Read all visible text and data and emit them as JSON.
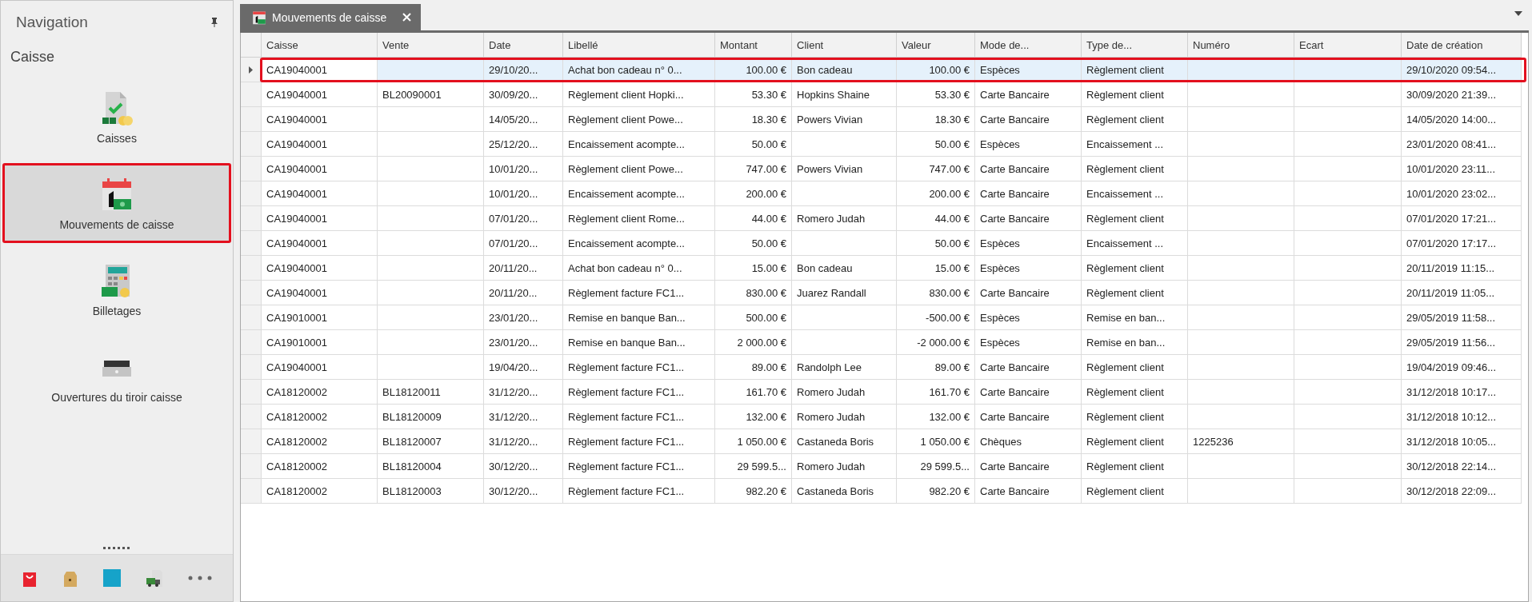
{
  "sidebar": {
    "title": "Navigation",
    "section": "Caisse",
    "items": [
      {
        "label": "Caisses",
        "selected": false
      },
      {
        "label": "Mouvements de caisse",
        "selected": true
      },
      {
        "label": "Billetages",
        "selected": false
      },
      {
        "label": "Ouvertures du tiroir caisse",
        "selected": false
      }
    ]
  },
  "tabs": [
    {
      "label": "Mouvements de caisse",
      "selected": true
    }
  ],
  "table": {
    "columns": [
      {
        "label": "Caisse",
        "kind": "text"
      },
      {
        "label": "Vente",
        "kind": "text"
      },
      {
        "label": "Date",
        "kind": "text"
      },
      {
        "label": "Libellé",
        "kind": "text"
      },
      {
        "label": "Montant",
        "kind": "amount"
      },
      {
        "label": "Client",
        "kind": "text"
      },
      {
        "label": "Valeur",
        "kind": "amount"
      },
      {
        "label": "Mode de...",
        "kind": "text"
      },
      {
        "label": "Type de...",
        "kind": "text"
      },
      {
        "label": "Numéro",
        "kind": "text"
      },
      {
        "label": "Ecart",
        "kind": "text"
      },
      {
        "label": "Date de création",
        "kind": "text"
      }
    ],
    "rows": [
      {
        "selected": true,
        "cells": [
          "CA19040001",
          null,
          "29/10/20...",
          "Achat bon cadeau n° 0...",
          "100.00 €",
          "Bon cadeau",
          "100.00 €",
          "Espèces",
          "Règlement client",
          null,
          null,
          "29/10/2020 09:54..."
        ]
      },
      {
        "selected": false,
        "cells": [
          "CA19040001",
          "BL20090001",
          "30/09/20...",
          "Règlement client Hopki...",
          "53.30 €",
          "Hopkins Shaine",
          "53.30 €",
          "Carte Bancaire",
          "Règlement client",
          null,
          null,
          "30/09/2020 21:39..."
        ]
      },
      {
        "selected": false,
        "cells": [
          "CA19040001",
          null,
          "14/05/20...",
          "Règlement client Powe...",
          "18.30 €",
          "Powers Vivian",
          "18.30 €",
          "Carte Bancaire",
          "Règlement client",
          null,
          null,
          "14/05/2020 14:00..."
        ]
      },
      {
        "selected": false,
        "cells": [
          "CA19040001",
          null,
          "25/12/20...",
          "Encaissement acompte...",
          "50.00 €",
          null,
          "50.00 €",
          "Espèces",
          "Encaissement ...",
          null,
          null,
          "23/01/2020 08:41..."
        ]
      },
      {
        "selected": false,
        "cells": [
          "CA19040001",
          null,
          "10/01/20...",
          "Règlement client Powe...",
          "747.00 €",
          "Powers Vivian",
          "747.00 €",
          "Carte Bancaire",
          "Règlement client",
          null,
          null,
          "10/01/2020 23:11..."
        ]
      },
      {
        "selected": false,
        "cells": [
          "CA19040001",
          null,
          "10/01/20...",
          "Encaissement acompte...",
          "200.00 €",
          null,
          "200.00 €",
          "Carte Bancaire",
          "Encaissement ...",
          null,
          null,
          "10/01/2020 23:02..."
        ]
      },
      {
        "selected": false,
        "cells": [
          "CA19040001",
          null,
          "07/01/20...",
          "Règlement client Rome...",
          "44.00 €",
          "Romero Judah",
          "44.00 €",
          "Carte Bancaire",
          "Règlement client",
          null,
          null,
          "07/01/2020 17:21..."
        ]
      },
      {
        "selected": false,
        "cells": [
          "CA19040001",
          null,
          "07/01/20...",
          "Encaissement acompte...",
          "50.00 €",
          null,
          "50.00 €",
          "Espèces",
          "Encaissement ...",
          null,
          null,
          "07/01/2020 17:17..."
        ]
      },
      {
        "selected": false,
        "cells": [
          "CA19040001",
          null,
          "20/11/20...",
          "Achat bon cadeau n° 0...",
          "15.00 €",
          "Bon cadeau",
          "15.00 €",
          "Espèces",
          "Règlement client",
          null,
          null,
          "20/11/2019 11:15..."
        ]
      },
      {
        "selected": false,
        "cells": [
          "CA19040001",
          null,
          "20/11/20...",
          "Règlement facture FC1...",
          "830.00 €",
          "Juarez Randall",
          "830.00 €",
          "Carte Bancaire",
          "Règlement client",
          null,
          null,
          "20/11/2019 11:05..."
        ]
      },
      {
        "selected": false,
        "cells": [
          "CA19010001",
          null,
          "23/01/20...",
          "Remise en banque Ban...",
          "500.00 €",
          null,
          "-500.00 €",
          "Espèces",
          "Remise en ban...",
          null,
          null,
          "29/05/2019 11:58..."
        ]
      },
      {
        "selected": false,
        "cells": [
          "CA19010001",
          null,
          "23/01/20...",
          "Remise en banque Ban...",
          "2 000.00 €",
          null,
          "-2 000.00 €",
          "Espèces",
          "Remise en ban...",
          null,
          null,
          "29/05/2019 11:56..."
        ]
      },
      {
        "selected": false,
        "cells": [
          "CA19040001",
          null,
          "19/04/20...",
          "Règlement facture FC1...",
          "89.00 €",
          "Randolph Lee",
          "89.00 €",
          "Carte Bancaire",
          "Règlement client",
          null,
          null,
          "19/04/2019 09:46..."
        ]
      },
      {
        "selected": false,
        "cells": [
          "CA18120002",
          "BL18120011",
          "31/12/20...",
          "Règlement facture FC1...",
          "161.70 €",
          "Romero Judah",
          "161.70 €",
          "Carte Bancaire",
          "Règlement client",
          null,
          null,
          "31/12/2018 10:17..."
        ]
      },
      {
        "selected": false,
        "cells": [
          "CA18120002",
          "BL18120009",
          "31/12/20...",
          "Règlement facture FC1...",
          "132.00 €",
          "Romero Judah",
          "132.00 €",
          "Carte Bancaire",
          "Règlement client",
          null,
          null,
          "31/12/2018 10:12..."
        ]
      },
      {
        "selected": false,
        "cells": [
          "CA18120002",
          "BL18120007",
          "31/12/20...",
          "Règlement facture FC1...",
          "1 050.00 €",
          "Castaneda Boris",
          "1 050.00 €",
          "Chèques",
          "Règlement client",
          "1225236",
          null,
          "31/12/2018 10:05..."
        ]
      },
      {
        "selected": false,
        "cells": [
          "CA18120002",
          "BL18120004",
          "30/12/20...",
          "Règlement facture FC1...",
          "29 599.5...",
          "Romero Judah",
          "29 599.5...",
          "Carte Bancaire",
          "Règlement client",
          null,
          null,
          "30/12/2018 22:14..."
        ]
      },
      {
        "selected": false,
        "cells": [
          "CA18120002",
          "BL18120003",
          "30/12/20...",
          "Règlement facture FC1...",
          "982.20 €",
          "Castaneda Boris",
          "982.20 €",
          "Carte Bancaire",
          "Règlement client",
          null,
          null,
          "30/12/2018 22:09..."
        ]
      }
    ]
  }
}
